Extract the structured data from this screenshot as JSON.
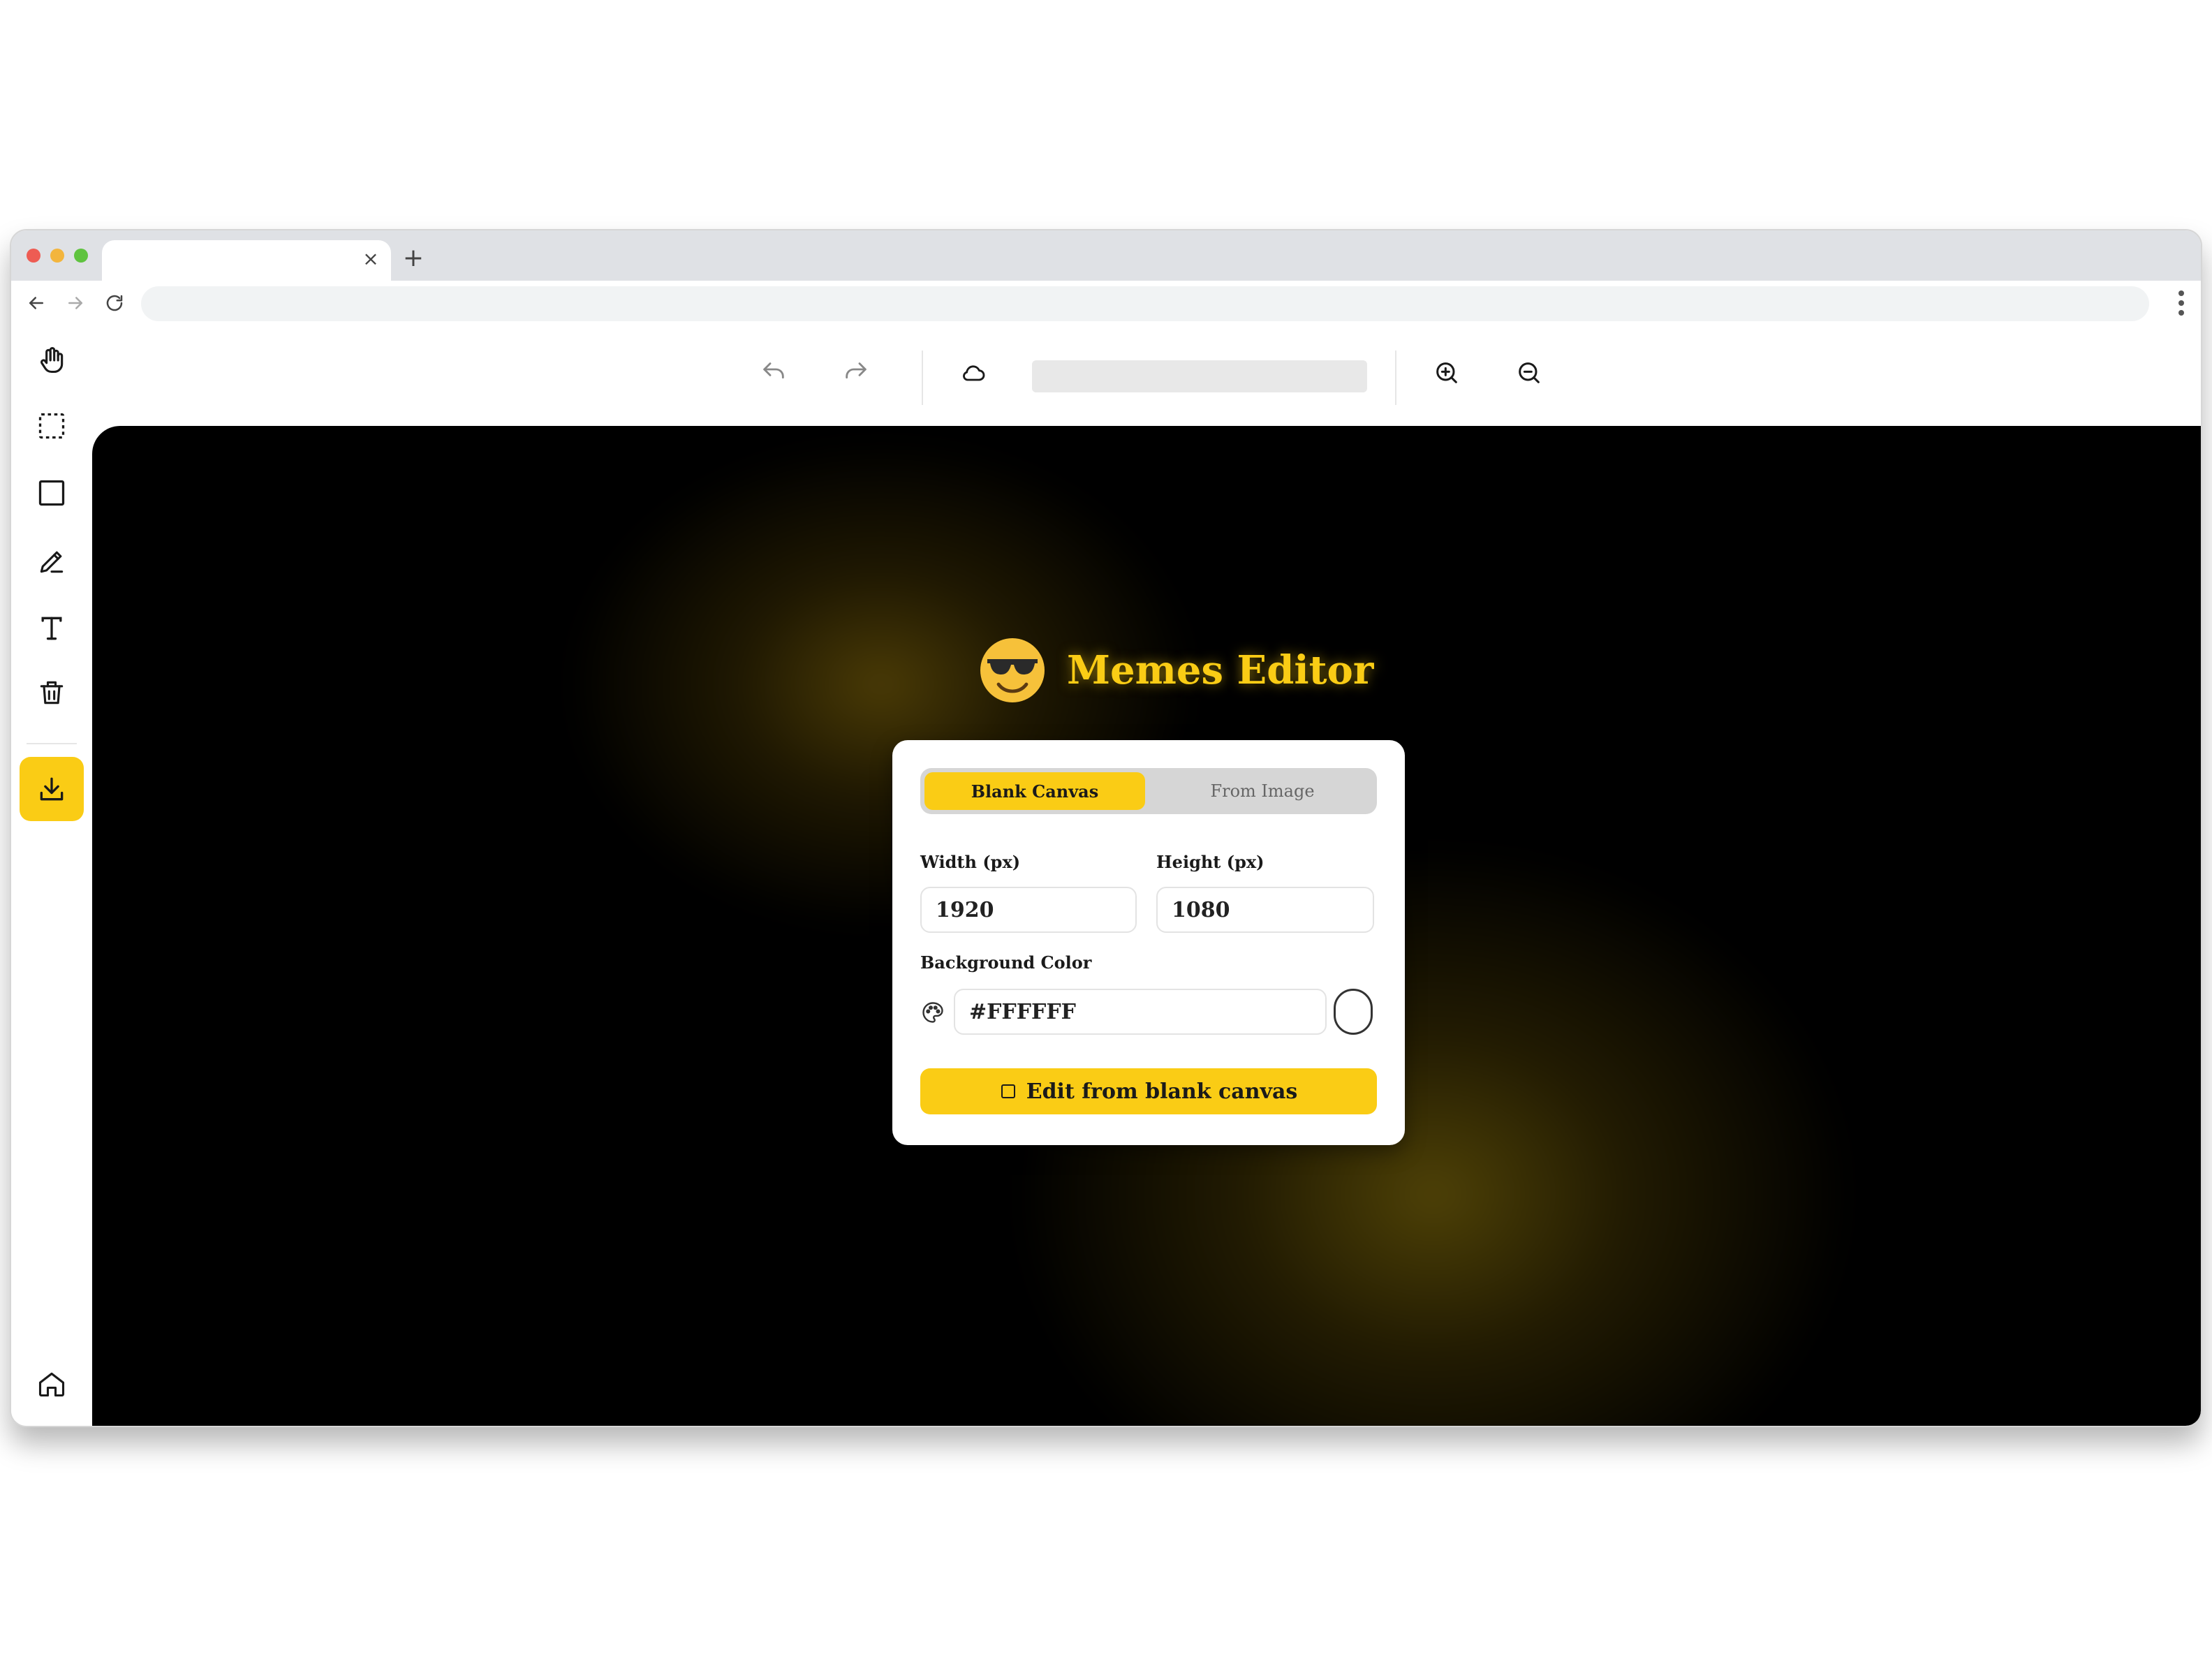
{
  "browser": {
    "tab": {
      "close_glyph": "×"
    },
    "new_tab_glyph": "+"
  },
  "toolbar": {
    "icons": [
      "undo-icon",
      "redo-icon",
      "cloud-icon",
      "zoom-in-icon",
      "zoom-out-icon"
    ]
  },
  "sidebar": {
    "tools": [
      "hand-icon",
      "select-icon",
      "rectangle-icon",
      "pencil-icon",
      "text-icon",
      "trash-icon",
      "download-icon",
      "home-icon"
    ]
  },
  "brand": {
    "title": "Memes Editor",
    "emoji_icon": "sunglasses-face-icon"
  },
  "modal": {
    "tabs": [
      {
        "label": "Blank Canvas",
        "active": true
      },
      {
        "label": "From Image",
        "active": false
      }
    ],
    "width_label": "Width (px)",
    "width_value": "1920",
    "height_label": "Height (px)",
    "height_value": "1080",
    "bg_label": "Background Color",
    "bg_value": "#FFFFFF",
    "cta_label": "Edit from blank canvas"
  },
  "colors": {
    "accent": "#facc15",
    "stage": "#000000",
    "swatch": "#FFFFFF"
  }
}
